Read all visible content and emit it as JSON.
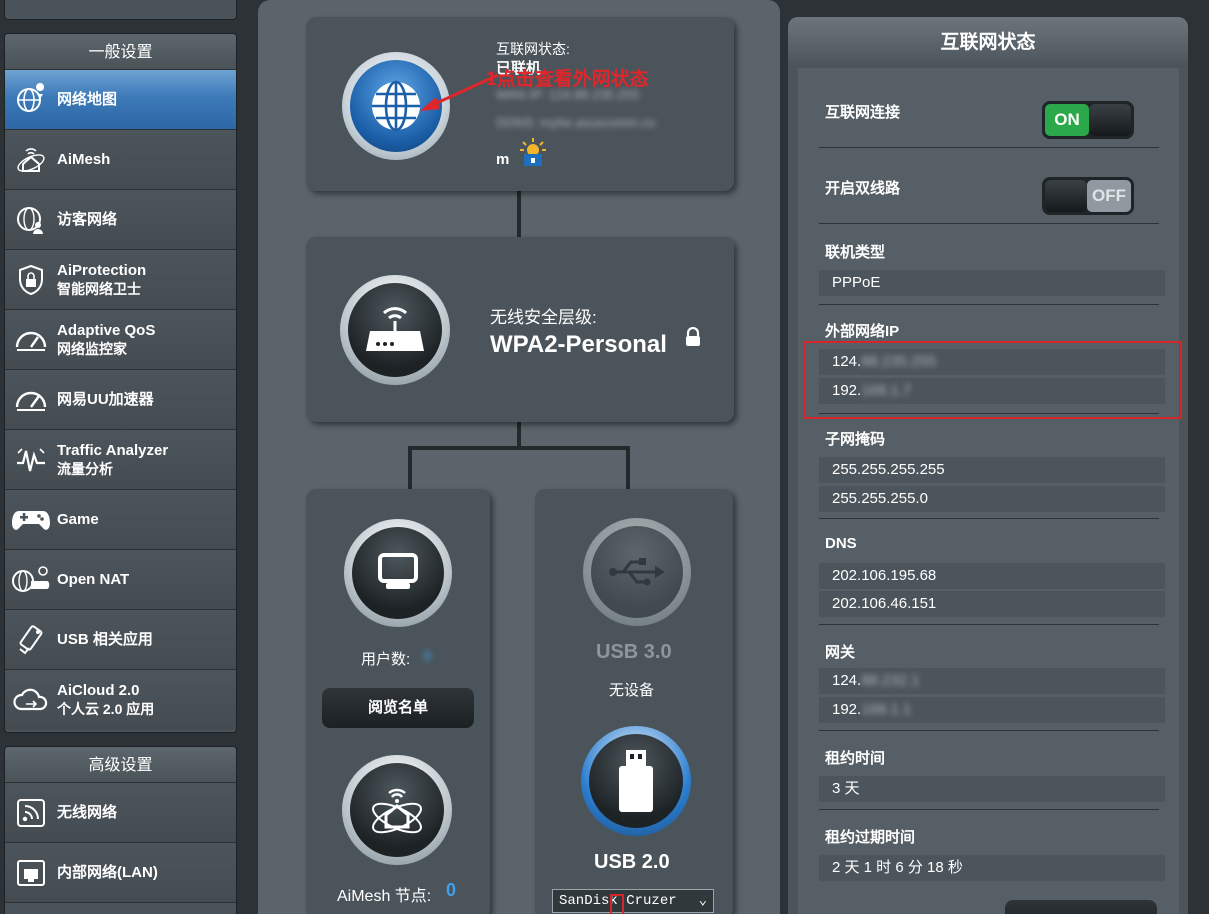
{
  "sidebar": {
    "general_title": "一般设置",
    "advanced_title": "高级设置",
    "items": [
      {
        "label": "网络地图",
        "sub": ""
      },
      {
        "label": "AiMesh",
        "sub": ""
      },
      {
        "label": "访客网络",
        "sub": ""
      },
      {
        "label": "AiProtection",
        "sub": "智能网络卫士"
      },
      {
        "label": "Adaptive QoS",
        "sub": "网络监控家"
      },
      {
        "label": "网易UU加速器",
        "sub": ""
      },
      {
        "label": "Traffic Analyzer",
        "sub": "流量分析"
      },
      {
        "label": "Game",
        "sub": ""
      },
      {
        "label": "Open NAT",
        "sub": ""
      },
      {
        "label": "USB 相关应用",
        "sub": ""
      },
      {
        "label": "AiCloud 2.0",
        "sub": "个人云 2.0 应用"
      }
    ],
    "advanced_items": [
      {
        "label": "无线网络"
      },
      {
        "label": "内部网络(LAN)"
      }
    ]
  },
  "map": {
    "internet_status_label": "互联网状态:",
    "internet_status_value": "已联机",
    "wan_ip_blurred": "WAN IP: 124.88.235.255",
    "ddns_blurred": "DDNS: myhe.asuscomm.co",
    "ddns_tail": "m",
    "annotation": "1点击查看外网状态",
    "security_label": "无线安全层级:",
    "security_value": "WPA2-Personal",
    "clients_label": "用户数:",
    "clients_value": "9",
    "view_list_button": "阅览名单",
    "aimesh_label": "AiMesh 节点:",
    "aimesh_value": "0",
    "usb3_label": "USB 3.0",
    "usb3_status": "无设备",
    "usb2_label": "USB 2.0",
    "usb_device": "SanDisk Cruzer"
  },
  "status": {
    "title": "互联网状态",
    "internet_connection_label": "互联网连接",
    "internet_connection_toggle": "ON",
    "dual_wan_label": "开启双线路",
    "dual_wan_toggle": "OFF",
    "conn_type_label": "联机类型",
    "conn_type_value": "PPPoE",
    "wan_ip_label": "外部网络IP",
    "wan_ip_1_visible": "124.",
    "wan_ip_1_hidden": "88.235.255",
    "wan_ip_2_visible": "192.",
    "wan_ip_2_hidden": "168.1.7",
    "subnet_label": "子网掩码",
    "subnet_1": "255.255.255.255",
    "subnet_2": "255.255.255.0",
    "dns_label": "DNS",
    "dns_1": "202.106.195.68",
    "dns_2": "202.106.46.151",
    "gateway_label": "网关",
    "gateway_1_visible": "124.",
    "gateway_1_hidden": "88.232.1",
    "gateway_2_visible": "192.",
    "gateway_2_hidden": "168.1.1",
    "lease_label": "租约时间",
    "lease_value": "3 天",
    "lease_expire_label": "租约过期时间",
    "lease_expire_value": "2 天 1 时 6 分 18 秒"
  },
  "colors": {
    "active_blue": "#2c67a6",
    "toggle_on_green": "#2ba84a",
    "annotation_red": "#e0262b",
    "usb_badge_blue": "#1e6fc0",
    "aimesh_count_blue": "#3fa0ee"
  }
}
